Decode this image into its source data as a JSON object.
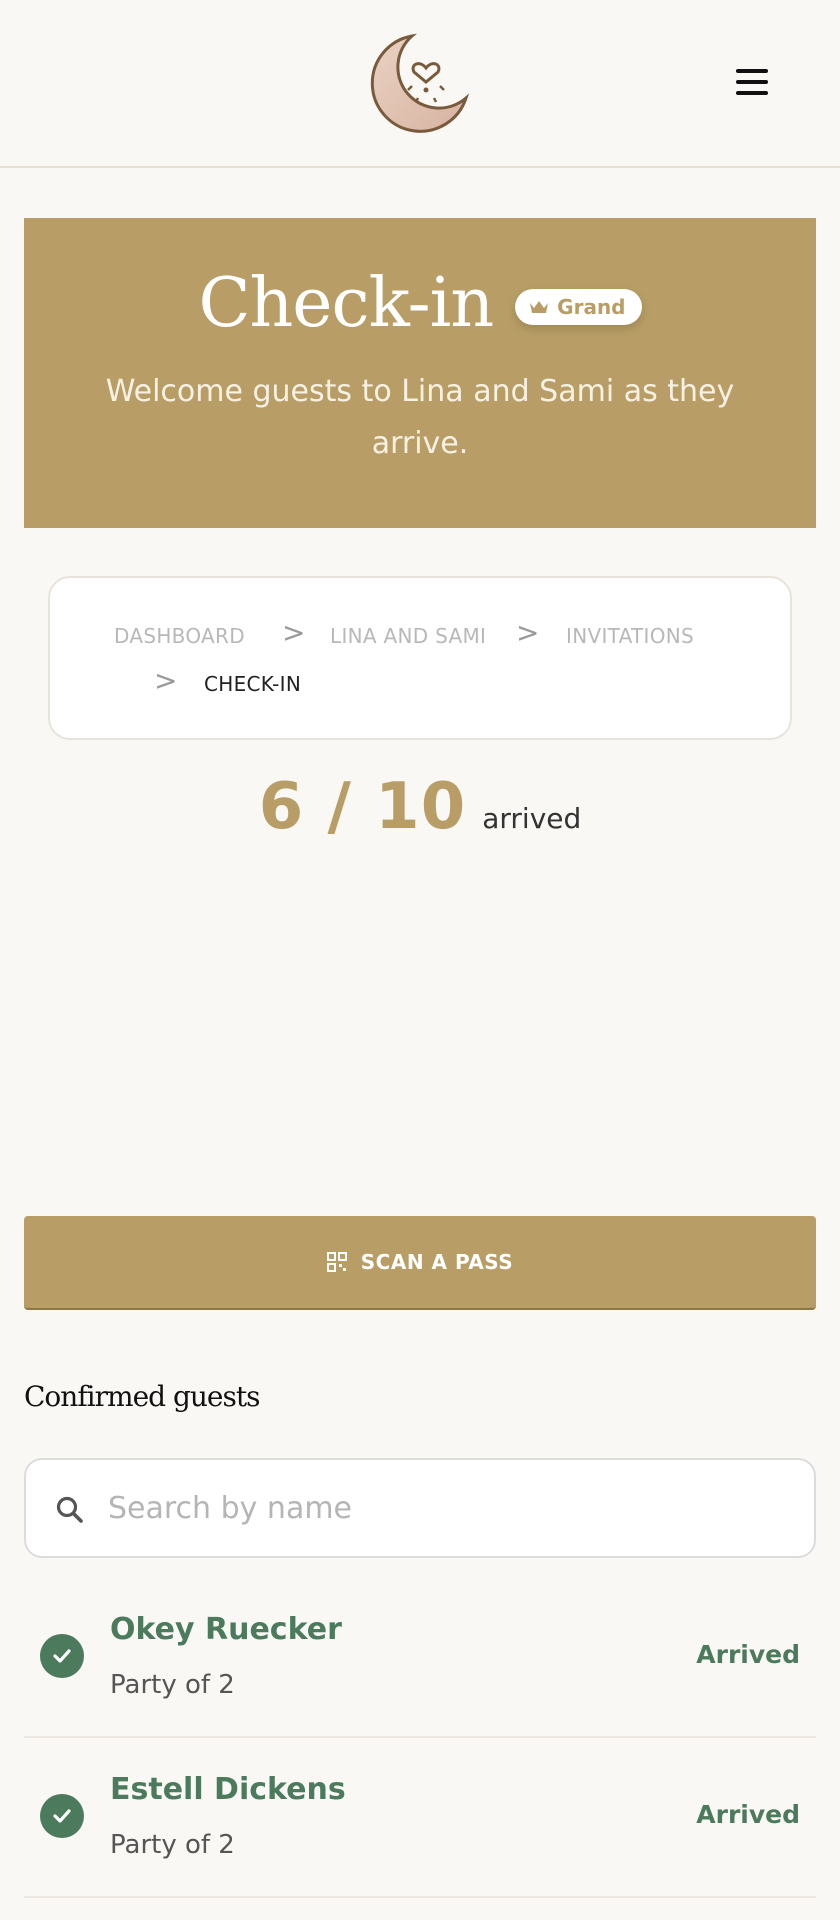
{
  "header": {
    "logo_icon": "crescent-moon-heart-logo",
    "menu_icon": "hamburger-menu-icon"
  },
  "hero": {
    "title": "Check-in",
    "badge_label": "Grand",
    "badge_icon": "crown-icon",
    "subtitle": "Welcome guests to Lina and Sami as they arrive.",
    "background_color": "#b89e66"
  },
  "breadcrumb": {
    "items": [
      {
        "label": "DASHBOARD"
      },
      {
        "label": "LINA AND SAMI"
      },
      {
        "label": "INVITATIONS"
      },
      {
        "label": "CHECK-IN"
      }
    ],
    "separator": ">"
  },
  "stats": {
    "arrived_count": "6 / 10",
    "arrived_label": "arrived"
  },
  "scan": {
    "label": "SCAN A PASS",
    "icon": "qr-code-icon"
  },
  "guests_section": {
    "title": "Confirmed guests",
    "search_placeholder": "Search by name",
    "search_value": "",
    "guests": [
      {
        "name": "Okey Ruecker",
        "party": "Party of 2",
        "status": "Arrived"
      },
      {
        "name": "Estell Dickens",
        "party": "Party of 2",
        "status": "Arrived"
      }
    ]
  },
  "colors": {
    "accent": "#b89e66",
    "success": "#4c7a5d",
    "background": "#f9f8f4"
  }
}
